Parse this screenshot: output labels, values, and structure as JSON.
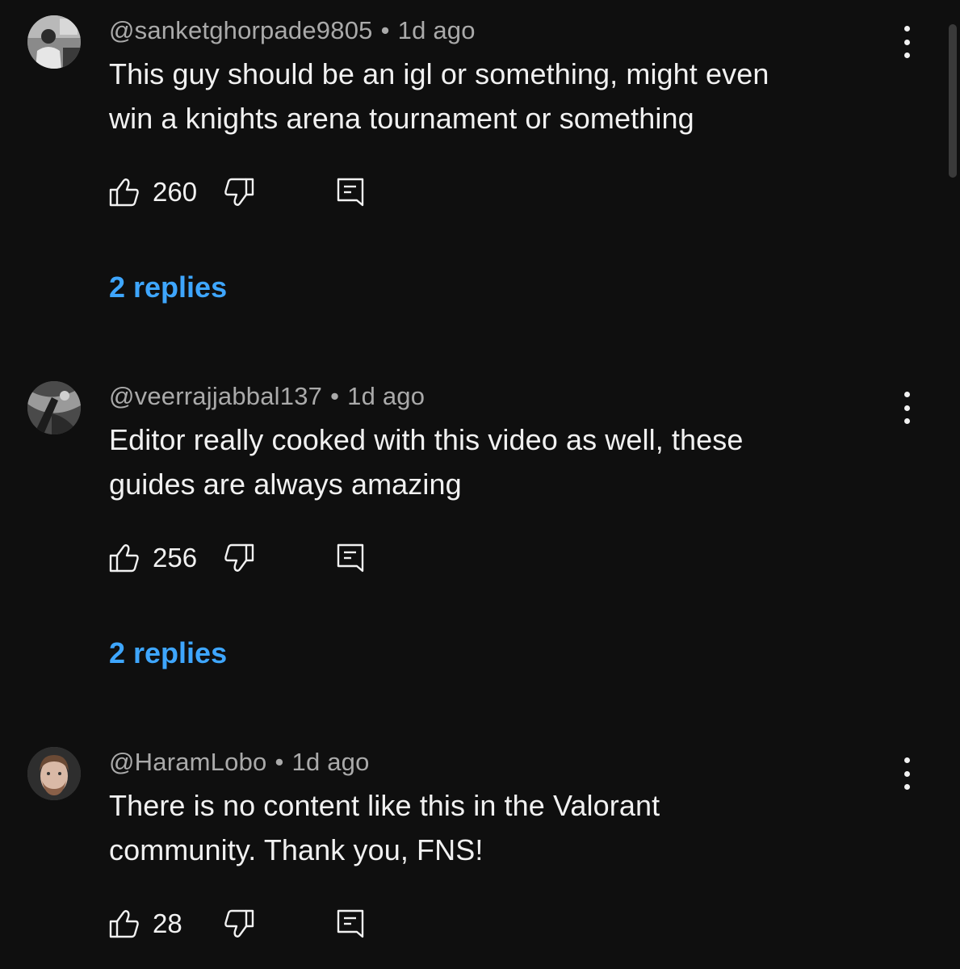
{
  "comments": [
    {
      "handle": "@sanketghorpade9805",
      "separator": "•",
      "time": "1d ago",
      "text_line1": "This guy should be an igl or something,  might even",
      "text_line2": "win a knights arena tournament or something",
      "likes": "260",
      "replies": "2 replies",
      "avatar": "photo-grayscale-person"
    },
    {
      "handle": "@veerrajjabbal137",
      "separator": "•",
      "time": "1d ago",
      "text_line1": "Editor really cooked with this video as well, these",
      "text_line2": "guides are always amazing",
      "likes": "256",
      "replies": "2 replies",
      "avatar": "photo-dark-artwork"
    },
    {
      "handle": "@HaramLobo",
      "separator": "•",
      "time": "1d ago",
      "text_line1": "There is no content like this in the Valorant",
      "text_line2": "community. Thank you, FNS!",
      "likes": "28",
      "replies": null,
      "avatar": "photo-bearded-man"
    }
  ],
  "icons": {
    "like": "thumbs-up-icon",
    "dislike": "thumbs-down-icon",
    "reply": "comment-reply-icon",
    "more": "vertical-dots-icon"
  },
  "colors": {
    "background": "#0f0f0f",
    "text": "#f1f1f1",
    "secondary": "#aaaaaa",
    "link": "#3ea6ff"
  }
}
